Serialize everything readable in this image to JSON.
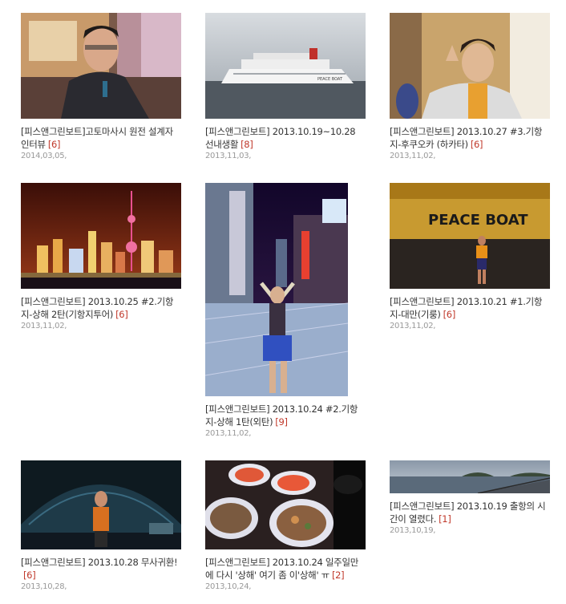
{
  "posts": [
    {
      "title": "[피스앤그린보트]고토마사시 원전 설계자 인터뷰",
      "count": "[6]",
      "date": "2014,03,05,"
    },
    {
      "title": "[피스앤그린보트] 2013.10.19~10.28 선내생활",
      "count": "[8]",
      "date": "2013,11,03,"
    },
    {
      "title": "[피스앤그린보트] 2013.10.27 #3.기항지-후쿠오카 (하카타)",
      "count": "[6]",
      "date": "2013,11,02,"
    },
    {
      "title": "[피스앤그린보트] 2013.10.25 #2.기항지-상해 2탄(기항지투어)",
      "count": "[6]",
      "date": "2013,11,02,"
    },
    {
      "title": "[피스앤그린보트] 2013.10.24 #2.기항지-상해 1탄(외탄)",
      "count": "[9]",
      "date": "2013,11,02,"
    },
    {
      "title": "[피스앤그린보트] 2013.10.21 #1.기항지-대만(기룽)",
      "count": "[6]",
      "date": "2013,11,02,"
    },
    {
      "title": "[피스앤그린보트] 2013.10.28 무사귀환!",
      "count": "[6]",
      "date": "2013,10,28,"
    },
    {
      "title": "[피스앤그린보트] 2013.10.24 일주일만에 다시 '상해' 여기 좀 이'상해' ㅠ",
      "count": "[2]",
      "date": "2013,10,24,"
    },
    {
      "title": "[피스앤그린보트] 2013.10.19 출항의 시간이 열렸다.",
      "count": "[1]",
      "date": "2013,10,19,"
    }
  ],
  "photo_text": {
    "ship_name": "PEACE BOAT",
    "wall_text": "PEACE BOAT"
  },
  "colors": {
    "count": "#c0392b",
    "title": "#333333",
    "date": "#999999"
  }
}
